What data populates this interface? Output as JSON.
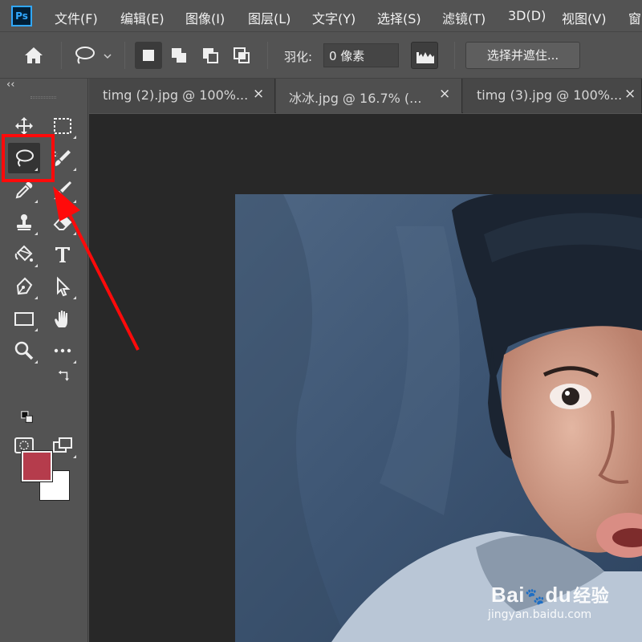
{
  "app": {
    "logo": "Ps"
  },
  "menu": [
    "文件(F)",
    "编辑(E)",
    "图像(I)",
    "图层(L)",
    "文字(Y)",
    "选择(S)",
    "滤镜(T)",
    "3D(D)",
    "视图(V)",
    "窗"
  ],
  "options": {
    "feather_label": "羽化:",
    "feather_value": "0 像素",
    "select_mask": "选择并遮住..."
  },
  "toolbar": {
    "collapse": "‹‹",
    "foreground_color": "#b53c4c",
    "background_color": "#ffffff"
  },
  "tabs": [
    {
      "label": "timg (2).jpg @ 100%...",
      "close": "×"
    },
    {
      "label": "冰冰.jpg @ 16.7% (...",
      "close": "×"
    },
    {
      "label": "timg (3).jpg @ 100%...",
      "close": "×"
    }
  ],
  "annotation": {
    "highlight_color": "#ff0a0a"
  },
  "watermark": {
    "brand": "Bai",
    "brand2": "du",
    "suffix": "经验",
    "url": "jingyan.baidu.com"
  }
}
